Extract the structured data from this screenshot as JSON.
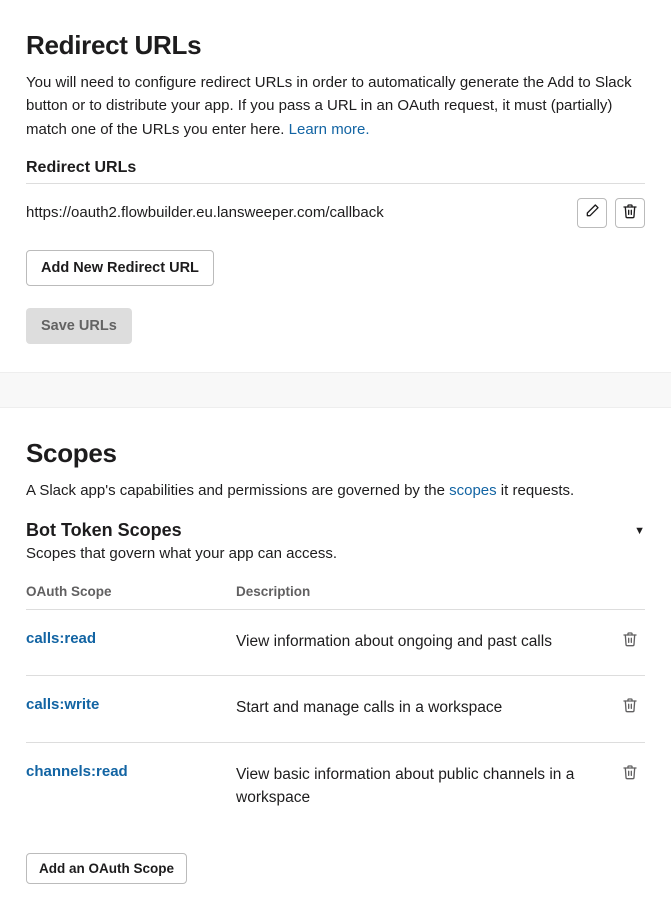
{
  "redirect": {
    "title": "Redirect URLs",
    "description_pre": "You will need to configure redirect URLs in order to automatically generate the Add to Slack button or to distribute your app. If you pass a URL in an OAuth request, it must (partially) match one of the URLs you enter here. ",
    "learn_more": "Learn more.",
    "list_heading": "Redirect URLs",
    "urls": [
      {
        "value": "https://oauth2.flowbuilder.eu.lansweeper.com/callback"
      }
    ],
    "add_button": "Add New Redirect URL",
    "save_button": "Save URLs"
  },
  "scopes": {
    "title": "Scopes",
    "description_pre": "A Slack app's capabilities and permissions are governed by the ",
    "scopes_link": "scopes",
    "description_post": " it requests.",
    "bot_heading": "Bot Token Scopes",
    "bot_sub": "Scopes that govern what your app can access.",
    "col_scope": "OAuth Scope",
    "col_desc": "Description",
    "rows": [
      {
        "name": "calls:read",
        "description": "View information about ongoing and past calls"
      },
      {
        "name": "calls:write",
        "description": "Start and manage calls in a workspace"
      },
      {
        "name": "channels:read",
        "description": "View basic information about public channels in a workspace"
      }
    ],
    "add_button": "Add an OAuth Scope"
  }
}
